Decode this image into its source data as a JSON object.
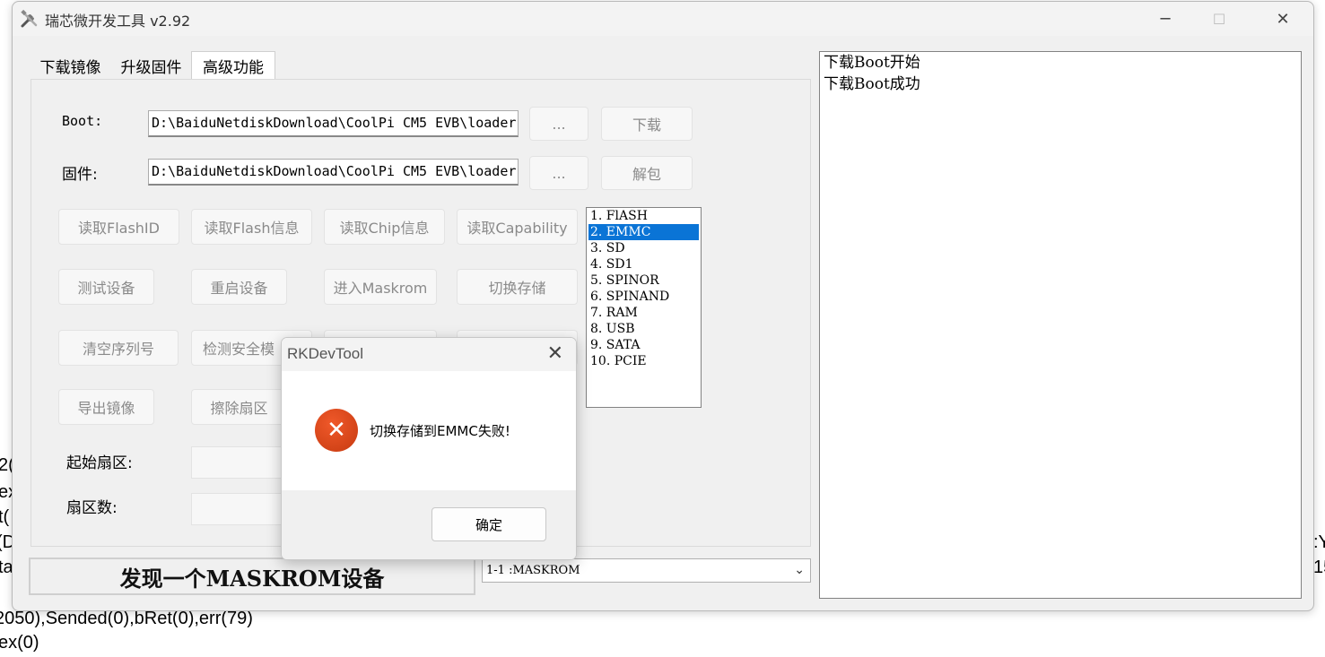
{
  "background_console": {
    "lines": [
      "2(",
      "ex",
      "t(",
      "(D",
      "ta",
      "2050),Sended(0),bRet(0),err(79)",
      "ex(0)"
    ],
    "right_fragments": [
      ":Y",
      "15"
    ]
  },
  "window": {
    "title": "瑞芯微开发工具 v2.92",
    "minimize_icon": "─",
    "maximize_icon": "☐",
    "close_icon": "✕"
  },
  "tabs": [
    {
      "label": "下载镜像",
      "active": false
    },
    {
      "label": "升级固件",
      "active": false
    },
    {
      "label": "高级功能",
      "active": true
    }
  ],
  "advanced": {
    "boot_label": "Boot:",
    "boot_path": "D:\\BaiduNetdiskDownload\\CoolPi CM5 EVB\\loader",
    "firmware_label": "固件:",
    "firmware_path": "D:\\BaiduNetdiskDownload\\CoolPi CM5 EVB\\loader",
    "browse_label": "...",
    "download_label": "下载",
    "unpack_label": "解包",
    "buttons_row1": [
      "读取FlashID",
      "读取Flash信息",
      "读取Chip信息",
      "读取Capability"
    ],
    "buttons_row2": [
      "测试设备",
      "重启设备",
      "进入Maskrom",
      "切换存储"
    ],
    "buttons_row3": [
      "清空序列号",
      "检测安全模"
    ],
    "buttons_row4": [
      "导出镜像",
      "擦除扇区"
    ],
    "start_sector_label": "起始扇区:",
    "sector_count_label": "扇区数:"
  },
  "storage_list": {
    "items": [
      "1. FlASH",
      "2. EMMC",
      "3. SD",
      "4. SD1",
      "5. SPINOR",
      "6. SPINAND",
      "7. RAM",
      "8. USB",
      "9. SATA",
      "10. PCIE"
    ],
    "selected_index": 1
  },
  "status": {
    "text": "发现一个MASKROM设备",
    "device_select": "1-1 :MASKROM"
  },
  "log": {
    "lines": [
      "下载Boot开始",
      "下载Boot成功"
    ]
  },
  "dialog": {
    "title": "RKDevTool",
    "message": "切换存储到EMMC失败!",
    "ok_label": "确定",
    "close_icon": "✕",
    "error_glyph": "✕"
  },
  "colors": {
    "selection": "#0a74d6",
    "error_icon": "#e0481c"
  }
}
